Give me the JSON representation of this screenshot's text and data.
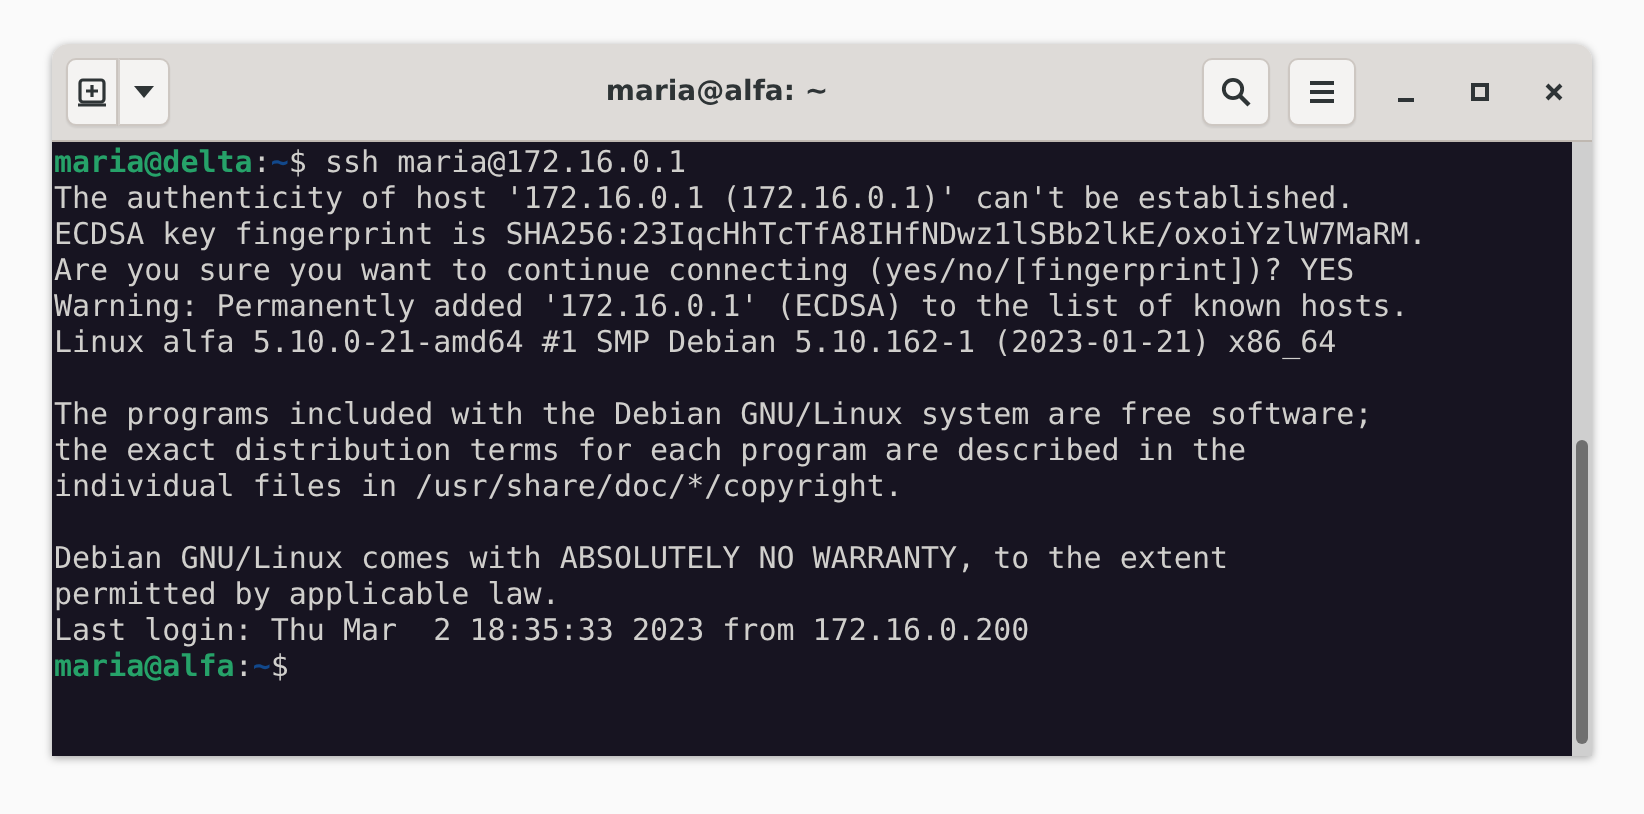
{
  "window": {
    "title": "maria@alfa: ~"
  },
  "terminal": {
    "lines": [
      {
        "kind": "prompt",
        "user_host": "maria@delta",
        "separator": ":",
        "path": "~",
        "symbol": "$",
        "command": "ssh maria@172.16.0.1"
      },
      {
        "kind": "text",
        "text": "The authenticity of host '172.16.0.1 (172.16.0.1)' can't be established."
      },
      {
        "kind": "text",
        "text": "ECDSA key fingerprint is SHA256:23IqcHhTcTfA8IHfNDwz1lSBb2lkE/oxoiYzlW7MaRM."
      },
      {
        "kind": "text",
        "text": "Are you sure you want to continue connecting (yes/no/[fingerprint])? YES"
      },
      {
        "kind": "text",
        "text": "Warning: Permanently added '172.16.0.1' (ECDSA) to the list of known hosts."
      },
      {
        "kind": "text",
        "text": "Linux alfa 5.10.0-21-amd64 #1 SMP Debian 5.10.162-1 (2023-01-21) x86_64"
      },
      {
        "kind": "blank"
      },
      {
        "kind": "text",
        "text": "The programs included with the Debian GNU/Linux system are free software;"
      },
      {
        "kind": "text",
        "text": "the exact distribution terms for each program are described in the"
      },
      {
        "kind": "text",
        "text": "individual files in /usr/share/doc/*/copyright."
      },
      {
        "kind": "blank"
      },
      {
        "kind": "text",
        "text": "Debian GNU/Linux comes with ABSOLUTELY NO WARRANTY, to the extent"
      },
      {
        "kind": "text",
        "text": "permitted by applicable law."
      },
      {
        "kind": "text",
        "text": "Last login: Thu Mar  2 18:35:33 2023 from 172.16.0.200"
      },
      {
        "kind": "prompt",
        "user_host": "maria@alfa",
        "separator": ":",
        "path": "~",
        "symbol": "$"
      }
    ]
  }
}
